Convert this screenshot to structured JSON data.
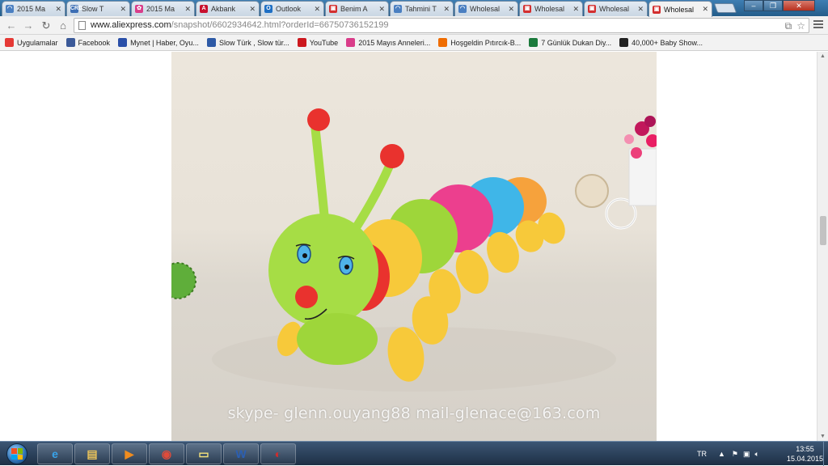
{
  "tabs": [
    {
      "title": "2015 Ma",
      "fav_color": "#4a7fc1",
      "fav": "◠"
    },
    {
      "title": "Slow T",
      "fav_color": "#3c6eb4",
      "fav": "CRD"
    },
    {
      "title": "2015 Ma",
      "fav_color": "#d93d8a",
      "fav": "✿"
    },
    {
      "title": "Akbank",
      "fav_color": "#c8102e",
      "fav": "A"
    },
    {
      "title": "Outlook",
      "fav_color": "#1e6fc4",
      "fav": "O"
    },
    {
      "title": "Benim A",
      "fav_color": "#d32f2f",
      "fav": "▣"
    },
    {
      "title": "Tahmini T",
      "fav_color": "#4a7fc1",
      "fav": "◠"
    },
    {
      "title": "Wholesal",
      "fav_color": "#4a7fc1",
      "fav": "◠"
    },
    {
      "title": "Wholesal",
      "fav_color": "#d32f2f",
      "fav": "▣"
    },
    {
      "title": "Wholesal",
      "fav_color": "#d32f2f",
      "fav": "▣"
    },
    {
      "title": "Wholesal",
      "fav_color": "#d32f2f",
      "fav": "▣",
      "active": true
    }
  ],
  "address": {
    "host": "www.aliexpress.com",
    "path": "/snapshot/6602934642.html?orderId=66750736152199"
  },
  "bookmarks": [
    {
      "label": "Uygulamalar",
      "color": "#e53935",
      "icon": "apps-icon"
    },
    {
      "label": "Facebook",
      "color": "#3b5998",
      "icon": "facebook-icon"
    },
    {
      "label": "Mynet | Haber, Oyu...",
      "color": "#2a4fa8",
      "icon": "mynet-icon"
    },
    {
      "label": "Slow Türk , Slow tür...",
      "color": "#2e5aa6",
      "icon": "slowturk-icon"
    },
    {
      "label": "YouTube",
      "color": "#cc181e",
      "icon": "youtube-icon"
    },
    {
      "label": "2015 Mayıs Anneleri...",
      "color": "#d93d8a",
      "icon": "flower-icon"
    },
    {
      "label": "Hoşgeldin Pıtırcık-B...",
      "color": "#ef6c00",
      "icon": "blogger-icon"
    },
    {
      "label": "7 Günlük Dukan Diy...",
      "color": "#1b7a3c",
      "icon": "dukan-icon"
    },
    {
      "label": "40,000+ Baby Show...",
      "color": "#222222",
      "icon": "baby-show-icon"
    }
  ],
  "product": {
    "watermark": "skype- glenn.ouyang88 mail-glenace@163.com"
  },
  "taskbar": {
    "apps": [
      {
        "name": "taskbar-ie",
        "glyph": "e",
        "color": "#38a3ea"
      },
      {
        "name": "taskbar-explorer",
        "glyph": "▤",
        "color": "#e8c15a"
      },
      {
        "name": "taskbar-media-player",
        "glyph": "▶",
        "color": "#f08c1e"
      },
      {
        "name": "taskbar-chrome",
        "glyph": "◉",
        "color": "#e04b3a"
      },
      {
        "name": "taskbar-notes",
        "glyph": "▭",
        "color": "#f5e27a"
      },
      {
        "name": "taskbar-word",
        "glyph": "W",
        "color": "#2b5fb3"
      },
      {
        "name": "taskbar-app",
        "glyph": "◐",
        "color": "#d42b2b"
      }
    ],
    "language": "TR",
    "time": "13:55",
    "date": "15.04.2015"
  }
}
